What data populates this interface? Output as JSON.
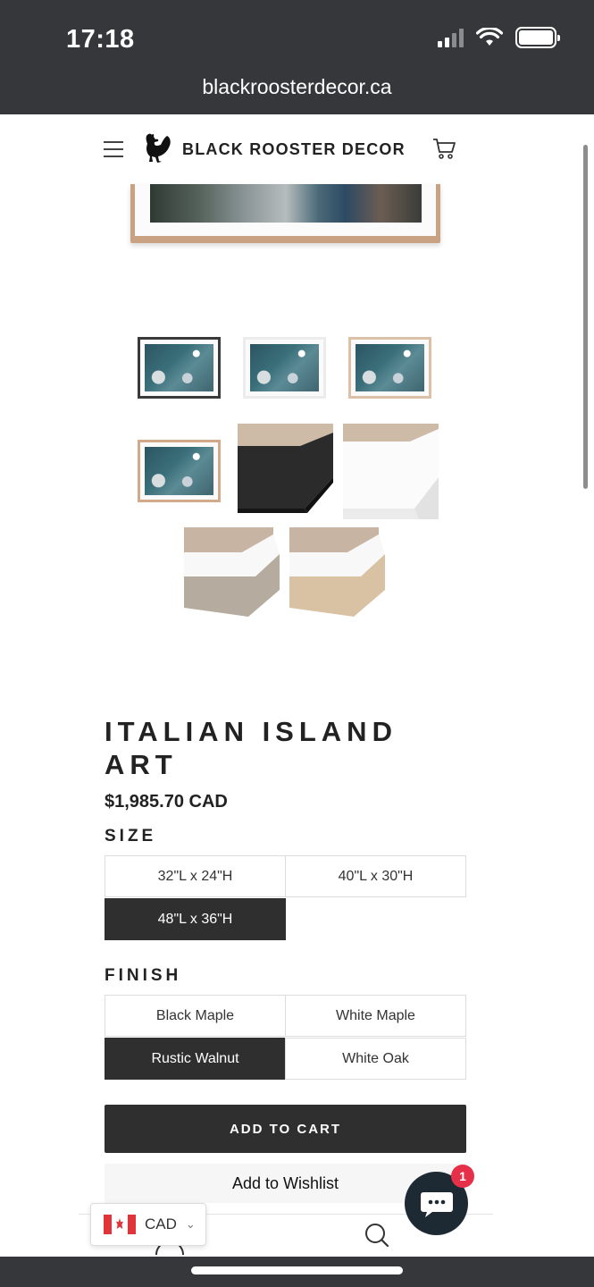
{
  "status_bar": {
    "time": "17:18"
  },
  "browser": {
    "url": "blackroosterdecor.ca"
  },
  "header": {
    "brand": "BLACK ROOSTER DECOR"
  },
  "product": {
    "title": "ITALIAN ISLAND ART",
    "price": "$1,985.70 CAD",
    "size": {
      "label": "SIZE",
      "options": [
        "32\"L x 24\"H",
        "40\"L x 30\"H",
        "48\"L x 36\"H"
      ],
      "selected": "48\"L x 36\"H"
    },
    "finish": {
      "label": "FINISH",
      "options": [
        "Black Maple",
        "White Maple",
        "Rustic Walnut",
        "White Oak"
      ],
      "selected": "Rustic Walnut"
    },
    "add_to_cart": "ADD TO CART",
    "add_to_wishlist": "Add to Wishlist",
    "thumbnails": [
      {
        "kind": "black-frame"
      },
      {
        "kind": "white-frame"
      },
      {
        "kind": "light-wood-frame"
      },
      {
        "kind": "walnut-frame"
      },
      {
        "kind": "black-corner"
      },
      {
        "kind": "white-corner"
      },
      {
        "kind": "grey-oak-corner"
      },
      {
        "kind": "natural-oak-corner"
      }
    ]
  },
  "currency": {
    "code": "CAD"
  },
  "chat": {
    "badge": "1"
  },
  "colors": {
    "dark": "#2f2f2f",
    "topbar": "#35373a",
    "badge": "#e6304a",
    "chat": "#1e2a33"
  }
}
